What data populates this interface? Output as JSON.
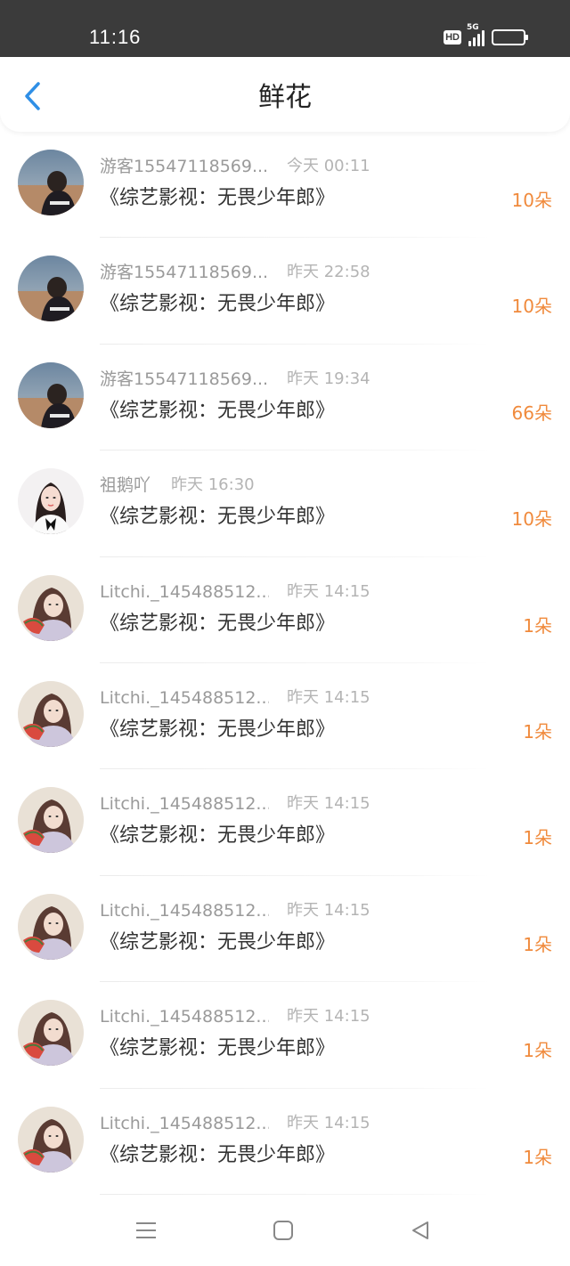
{
  "status_bar": {
    "time": "11:16",
    "hd_badge": "HD",
    "network": "5G"
  },
  "header": {
    "title": "鲜花",
    "accent_color": "#2f8fe6"
  },
  "colors": {
    "count": "#f08a3c",
    "username": "#9a9a9a",
    "time": "#b4b4b4"
  },
  "items": [
    {
      "username": "游客15547118569...",
      "time": "今天 00:11",
      "title": "《综艺影视：无畏少年郎》",
      "count": "10朵",
      "avatar": "sea-avatar"
    },
    {
      "username": "游客15547118569...",
      "time": "昨天 22:58",
      "title": "《综艺影视：无畏少年郎》",
      "count": "10朵",
      "avatar": "sea-avatar"
    },
    {
      "username": "游客15547118569...",
      "time": "昨天 19:34",
      "title": "《综艺影视：无畏少年郎》",
      "count": "66朵",
      "avatar": "sea-avatar"
    },
    {
      "username": "祖鹅吖",
      "time": "昨天 16:30",
      "title": "《综艺影视：无畏少年郎》",
      "count": "10朵",
      "avatar": "woman-avatar"
    },
    {
      "username": "Litchi._145488512...",
      "time": "昨天 14:15",
      "title": "《综艺影视：无畏少年郎》",
      "count": "1朵",
      "avatar": "girl-avatar"
    },
    {
      "username": "Litchi._145488512...",
      "time": "昨天 14:15",
      "title": "《综艺影视：无畏少年郎》",
      "count": "1朵",
      "avatar": "girl-avatar"
    },
    {
      "username": "Litchi._145488512...",
      "time": "昨天 14:15",
      "title": "《综艺影视：无畏少年郎》",
      "count": "1朵",
      "avatar": "girl-avatar"
    },
    {
      "username": "Litchi._145488512...",
      "time": "昨天 14:15",
      "title": "《综艺影视：无畏少年郎》",
      "count": "1朵",
      "avatar": "girl-avatar"
    },
    {
      "username": "Litchi._145488512...",
      "time": "昨天 14:15",
      "title": "《综艺影视：无畏少年郎》",
      "count": "1朵",
      "avatar": "girl-avatar"
    },
    {
      "username": "Litchi._145488512...",
      "time": "昨天 14:15",
      "title": "《综艺影视：无畏少年郎》",
      "count": "1朵",
      "avatar": "girl-avatar"
    }
  ],
  "nav_bar": {
    "buttons": [
      "menu-icon",
      "home-square-icon",
      "back-triangle-icon"
    ]
  }
}
